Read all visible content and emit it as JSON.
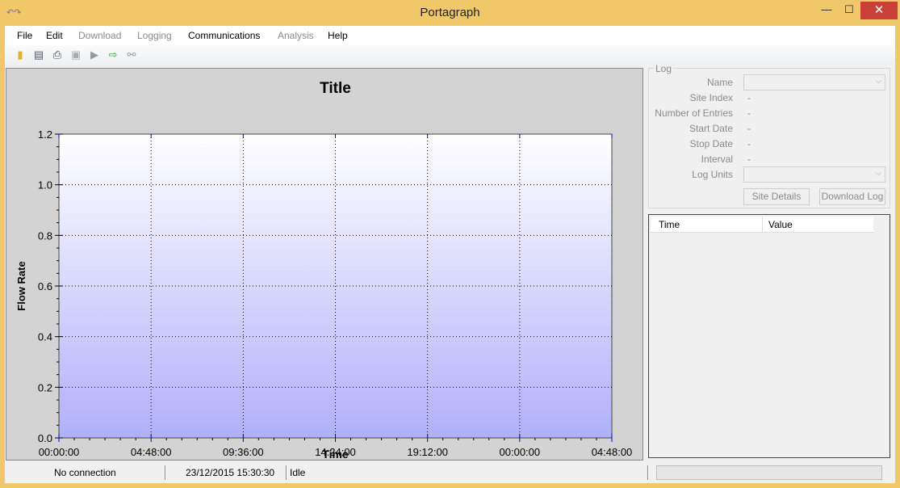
{
  "window": {
    "title": "Portagraph",
    "minimize": "—",
    "maximize": "☐",
    "close": "✕"
  },
  "menu": [
    {
      "label": "File",
      "enabled": true
    },
    {
      "label": "Edit",
      "enabled": true
    },
    {
      "label": "Download",
      "enabled": false
    },
    {
      "label": "Logging",
      "enabled": false
    },
    {
      "label": "Communications",
      "enabled": true
    },
    {
      "label": "Analysis",
      "enabled": false
    },
    {
      "label": "Help",
      "enabled": true
    }
  ],
  "toolbar": [
    "open-folder-icon",
    "save-icon",
    "print-icon",
    "download-icon",
    "play-icon",
    "export-icon",
    "network-icon"
  ],
  "chart_data": {
    "type": "line",
    "title": "Title",
    "xlabel": "Time",
    "ylabel": "Flow Rate",
    "ylim": [
      0,
      1.2
    ],
    "yticks": [
      "0.0",
      "0.2",
      "0.4",
      "0.6",
      "0.8",
      "1.0",
      "1.2"
    ],
    "xticks": [
      "00:00:00",
      "04:48:00",
      "09:36:00",
      "14:24:00",
      "19:12:00",
      "00:00:00",
      "04:48:00"
    ],
    "grid": true,
    "series": [],
    "colors": {
      "background_top": "#ffffff",
      "background_bottom": "#b0b0fa",
      "grid": "#000000"
    }
  },
  "log": {
    "group_label": "Log",
    "fields": [
      {
        "label": "Name",
        "type": "combo",
        "value": ""
      },
      {
        "label": "Site Index",
        "value": "-"
      },
      {
        "label": "Number of Entries",
        "value": "-"
      },
      {
        "label": "Start Date",
        "value": "-"
      },
      {
        "label": "Stop Date",
        "value": "-"
      },
      {
        "label": "Interval",
        "value": "-"
      },
      {
        "label": "Log Units",
        "type": "combo",
        "value": ""
      }
    ],
    "site_details_button": "Site Details",
    "download_log_button": "Download Log"
  },
  "table": {
    "columns": [
      "Time",
      "Value"
    ],
    "rows": []
  },
  "status": {
    "connection": "No connection",
    "datetime": "23/12/2015 15:30:30",
    "state": "Idle",
    "progress": 0
  }
}
